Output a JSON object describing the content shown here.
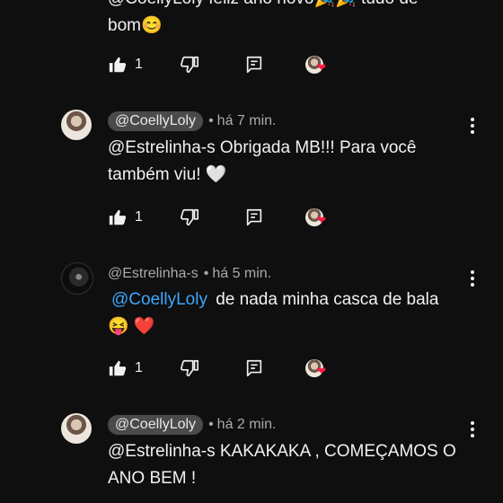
{
  "comment0": {
    "partial_text": "@CoellyLoly  feliz ano novo🎉🎉  tudo de",
    "text_line2": "bom😊",
    "like_count": "1"
  },
  "comment1": {
    "handle": "@CoellyLoly",
    "time": "há 7 min.",
    "text": "@Estrelinha-s  Obrigada MB!!! Para você também viu! 🤍",
    "like_count": "1"
  },
  "comment2": {
    "handle": "@Estrelinha-s",
    "time": "há 5 min.",
    "mention": "@CoellyLoly",
    "text": "de nada minha casca de bala",
    "emoji": "😝 ❤️",
    "like_count": "1"
  },
  "comment3": {
    "handle": "@CoellyLoly",
    "time": "há 2 min.",
    "text": "@Estrelinha-s  KAKAKAKA , COMEÇAMOS O ANO BEM !"
  },
  "separator": "•",
  "icons": {
    "like": "thumbs-up-icon",
    "dislike": "thumbs-down-icon",
    "reply": "reply-icon",
    "creator_heart": "creator-heart-icon",
    "more": "more-vert-icon"
  },
  "colors": {
    "background": "#0f0f0f",
    "mention": "#3ea6ff",
    "heart": "#ff1744",
    "chip": "#4a4a4a"
  }
}
